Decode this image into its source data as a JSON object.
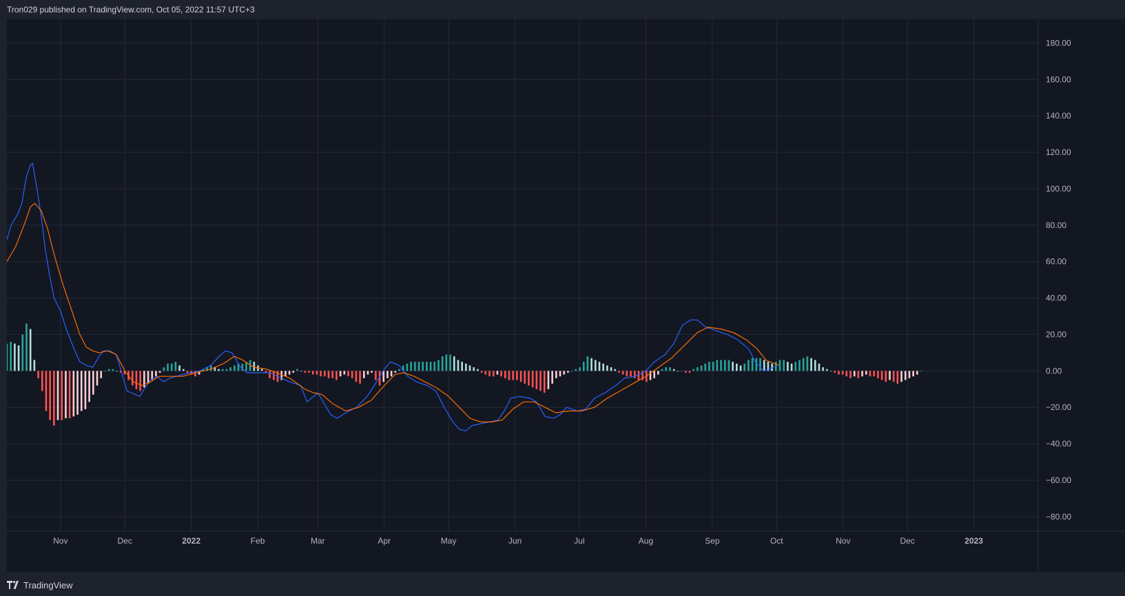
{
  "header": {
    "text": "Tron029 published on TradingView.com, Oct 05, 2022 11:57 UTC+3"
  },
  "footer": {
    "brand": "TradingView",
    "logo_icon": "tradingview-logo-icon"
  },
  "colors": {
    "background": "#131722",
    "frame": "#1e222d",
    "grid": "#252a37",
    "text": "#b2b5be",
    "macd_line": "#2962ff",
    "signal_line": "#ff6d00",
    "hist_pos_grow": "#26a69a",
    "hist_pos_fall": "#b2dfdb",
    "hist_neg_grow": "#ff5252",
    "hist_neg_fall": "#ffcdd2"
  },
  "chart_data": {
    "type": "line",
    "title": "",
    "xlabel": "",
    "ylabel": "",
    "x_range": [
      "2021-10-07",
      "2023-01-31"
    ],
    "ylim": [
      -88,
      193
    ],
    "grid": true,
    "x_ticks": [
      {
        "date": "2021-11-01",
        "label": "Nov",
        "bold": false
      },
      {
        "date": "2021-12-01",
        "label": "Dec",
        "bold": false
      },
      {
        "date": "2022-01-01",
        "label": "2022",
        "bold": true
      },
      {
        "date": "2022-02-01",
        "label": "Feb",
        "bold": false
      },
      {
        "date": "2022-03-01",
        "label": "Mar",
        "bold": false
      },
      {
        "date": "2022-04-01",
        "label": "Apr",
        "bold": false
      },
      {
        "date": "2022-05-01",
        "label": "May",
        "bold": false
      },
      {
        "date": "2022-06-01",
        "label": "Jun",
        "bold": false
      },
      {
        "date": "2022-07-01",
        "label": "Jul",
        "bold": false
      },
      {
        "date": "2022-08-01",
        "label": "Aug",
        "bold": false
      },
      {
        "date": "2022-09-01",
        "label": "Sep",
        "bold": false
      },
      {
        "date": "2022-10-01",
        "label": "Oct",
        "bold": false
      },
      {
        "date": "2022-11-01",
        "label": "Nov",
        "bold": false
      },
      {
        "date": "2022-12-01",
        "label": "Dec",
        "bold": false
      },
      {
        "date": "2023-01-01",
        "label": "2023",
        "bold": true
      }
    ],
    "y_ticks": [
      {
        "value": 180,
        "label": "180.00"
      },
      {
        "value": 160,
        "label": "160.00"
      },
      {
        "value": 140,
        "label": "140.00"
      },
      {
        "value": 120,
        "label": "120.00"
      },
      {
        "value": 100,
        "label": "100.00"
      },
      {
        "value": 80,
        "label": "80.00"
      },
      {
        "value": 60,
        "label": "60.00"
      },
      {
        "value": 40,
        "label": "40.00"
      },
      {
        "value": 20,
        "label": "20.00"
      },
      {
        "value": 0,
        "label": "0.00"
      },
      {
        "value": -20,
        "label": "−20.00"
      },
      {
        "value": -40,
        "label": "−40.00"
      },
      {
        "value": -60,
        "label": "−60.00"
      },
      {
        "value": -80,
        "label": "−80.00"
      }
    ],
    "series": [
      {
        "color_key": "macd_line",
        "points": [
          [
            "2021-10-07",
            72
          ],
          [
            "2021-10-09",
            80
          ],
          [
            "2021-10-12",
            86
          ],
          [
            "2021-10-14",
            92
          ],
          [
            "2021-10-16",
            106
          ],
          [
            "2021-10-18",
            113
          ],
          [
            "2021-10-19",
            114
          ],
          [
            "2021-10-21",
            100
          ],
          [
            "2021-10-23",
            85
          ],
          [
            "2021-10-25",
            66
          ],
          [
            "2021-10-27",
            52
          ],
          [
            "2021-10-29",
            40
          ],
          [
            "2021-11-01",
            33
          ],
          [
            "2021-11-04",
            22
          ],
          [
            "2021-11-07",
            13
          ],
          [
            "2021-11-10",
            5
          ],
          [
            "2021-11-13",
            3
          ],
          [
            "2021-11-16",
            2
          ],
          [
            "2021-11-19",
            8
          ],
          [
            "2021-11-21",
            11
          ],
          [
            "2021-11-24",
            11
          ],
          [
            "2021-11-27",
            9
          ],
          [
            "2021-11-30",
            -3
          ],
          [
            "2021-12-02",
            -11
          ],
          [
            "2021-12-04",
            -12
          ],
          [
            "2021-12-08",
            -14
          ],
          [
            "2021-12-10",
            -10
          ],
          [
            "2021-12-13",
            -5
          ],
          [
            "2021-12-16",
            -3
          ],
          [
            "2021-12-19",
            -6
          ],
          [
            "2021-12-22",
            -4
          ],
          [
            "2021-12-25",
            -3
          ],
          [
            "2021-12-31",
            -1
          ],
          [
            "2022-01-05",
            0
          ],
          [
            "2022-01-10",
            3
          ],
          [
            "2022-01-14",
            8
          ],
          [
            "2022-01-17",
            11
          ],
          [
            "2022-01-20",
            10
          ],
          [
            "2022-01-24",
            2
          ],
          [
            "2022-01-27",
            -1
          ],
          [
            "2022-02-01",
            -1
          ],
          [
            "2022-02-07",
            -1
          ],
          [
            "2022-02-12",
            -4
          ],
          [
            "2022-02-16",
            -6
          ],
          [
            "2022-02-21",
            -8
          ],
          [
            "2022-02-24",
            -17
          ],
          [
            "2022-02-27",
            -14
          ],
          [
            "2022-03-01",
            -12
          ],
          [
            "2022-03-04",
            -18
          ],
          [
            "2022-03-07",
            -24
          ],
          [
            "2022-03-10",
            -26
          ],
          [
            "2022-03-14",
            -23
          ],
          [
            "2022-03-19",
            -20
          ],
          [
            "2022-03-24",
            -14
          ],
          [
            "2022-03-29",
            -5
          ],
          [
            "2022-04-01",
            1
          ],
          [
            "2022-04-04",
            5
          ],
          [
            "2022-04-08",
            3
          ],
          [
            "2022-04-12",
            -3
          ],
          [
            "2022-04-16",
            -6
          ],
          [
            "2022-04-21",
            -8
          ],
          [
            "2022-04-25",
            -11
          ],
          [
            "2022-04-29",
            -20
          ],
          [
            "2022-05-03",
            -28
          ],
          [
            "2022-05-06",
            -32
          ],
          [
            "2022-05-09",
            -33
          ],
          [
            "2022-05-12",
            -30
          ],
          [
            "2022-05-16",
            -29
          ],
          [
            "2022-05-20",
            -28
          ],
          [
            "2022-05-24",
            -27
          ],
          [
            "2022-05-27",
            -22
          ],
          [
            "2022-05-30",
            -15
          ],
          [
            "2022-06-03",
            -14
          ],
          [
            "2022-06-08",
            -15
          ],
          [
            "2022-06-11",
            -17
          ],
          [
            "2022-06-15",
            -25
          ],
          [
            "2022-06-19",
            -26
          ],
          [
            "2022-06-22",
            -24
          ],
          [
            "2022-06-25",
            -20
          ],
          [
            "2022-06-30",
            -22
          ],
          [
            "2022-07-04",
            -21
          ],
          [
            "2022-07-08",
            -15
          ],
          [
            "2022-07-13",
            -12
          ],
          [
            "2022-07-18",
            -8
          ],
          [
            "2022-07-22",
            -4
          ],
          [
            "2022-07-27",
            -3
          ],
          [
            "2022-08-01",
            0
          ],
          [
            "2022-08-05",
            5
          ],
          [
            "2022-08-10",
            9
          ],
          [
            "2022-08-14",
            15
          ],
          [
            "2022-08-18",
            25
          ],
          [
            "2022-08-22",
            28
          ],
          [
            "2022-08-25",
            28
          ],
          [
            "2022-08-29",
            24
          ],
          [
            "2022-09-03",
            22
          ],
          [
            "2022-09-08",
            20
          ],
          [
            "2022-09-13",
            17
          ],
          [
            "2022-09-18",
            12
          ],
          [
            "2022-09-21",
            5
          ],
          [
            "2022-09-25",
            0
          ],
          [
            "2022-09-28",
            1
          ],
          [
            "2022-10-01",
            3
          ]
        ]
      },
      {
        "color_key": "signal_line",
        "points": [
          [
            "2021-10-07",
            60
          ],
          [
            "2021-10-11",
            68
          ],
          [
            "2021-10-15",
            80
          ],
          [
            "2021-10-18",
            90
          ],
          [
            "2021-10-20",
            92
          ],
          [
            "2021-10-23",
            88
          ],
          [
            "2021-10-26",
            78
          ],
          [
            "2021-10-29",
            64
          ],
          [
            "2021-11-02",
            48
          ],
          [
            "2021-11-06",
            34
          ],
          [
            "2021-11-10",
            20
          ],
          [
            "2021-11-13",
            13
          ],
          [
            "2021-11-16",
            11
          ],
          [
            "2021-11-19",
            10
          ],
          [
            "2021-11-23",
            11
          ],
          [
            "2021-11-27",
            9
          ],
          [
            "2021-12-01",
            0
          ],
          [
            "2021-12-05",
            -6
          ],
          [
            "2021-12-09",
            -8
          ],
          [
            "2021-12-13",
            -6
          ],
          [
            "2021-12-17",
            -3
          ],
          [
            "2021-12-22",
            -3
          ],
          [
            "2021-12-28",
            -3
          ],
          [
            "2022-01-03",
            -1
          ],
          [
            "2022-01-10",
            1
          ],
          [
            "2022-01-16",
            4
          ],
          [
            "2022-01-21",
            8
          ],
          [
            "2022-01-25",
            6
          ],
          [
            "2022-01-30",
            2
          ],
          [
            "2022-02-05",
            1
          ],
          [
            "2022-02-10",
            -1
          ],
          [
            "2022-02-16",
            -4
          ],
          [
            "2022-02-23",
            -10
          ],
          [
            "2022-02-27",
            -12
          ],
          [
            "2022-03-03",
            -13
          ],
          [
            "2022-03-08",
            -18
          ],
          [
            "2022-03-14",
            -22
          ],
          [
            "2022-03-20",
            -20
          ],
          [
            "2022-03-26",
            -16
          ],
          [
            "2022-04-01",
            -8
          ],
          [
            "2022-04-06",
            -2
          ],
          [
            "2022-04-10",
            -1
          ],
          [
            "2022-04-15",
            -3
          ],
          [
            "2022-04-20",
            -6
          ],
          [
            "2022-04-25",
            -9
          ],
          [
            "2022-05-01",
            -14
          ],
          [
            "2022-05-06",
            -20
          ],
          [
            "2022-05-11",
            -26
          ],
          [
            "2022-05-16",
            -28
          ],
          [
            "2022-05-21",
            -28
          ],
          [
            "2022-05-26",
            -27
          ],
          [
            "2022-05-31",
            -21
          ],
          [
            "2022-06-05",
            -17
          ],
          [
            "2022-06-10",
            -17
          ],
          [
            "2022-06-15",
            -20
          ],
          [
            "2022-06-20",
            -23
          ],
          [
            "2022-06-26",
            -22
          ],
          [
            "2022-07-02",
            -22
          ],
          [
            "2022-07-08",
            -20
          ],
          [
            "2022-07-14",
            -15
          ],
          [
            "2022-07-20",
            -11
          ],
          [
            "2022-07-26",
            -7
          ],
          [
            "2022-08-01",
            -3
          ],
          [
            "2022-08-07",
            2
          ],
          [
            "2022-08-13",
            7
          ],
          [
            "2022-08-19",
            14
          ],
          [
            "2022-08-25",
            21
          ],
          [
            "2022-08-30",
            24
          ],
          [
            "2022-09-05",
            23
          ],
          [
            "2022-09-11",
            21
          ],
          [
            "2022-09-17",
            17
          ],
          [
            "2022-09-22",
            12
          ],
          [
            "2022-09-26",
            6
          ],
          [
            "2022-09-30",
            4
          ],
          [
            "2022-10-02",
            3
          ]
        ]
      }
    ],
    "histogram": {
      "start": "2021-10-07",
      "step_days": 1.83,
      "values": [
        15,
        16,
        15,
        14,
        20,
        26,
        23,
        6,
        -4,
        -11,
        -22,
        -27,
        -30,
        -27,
        -27,
        -26,
        -26,
        -25,
        -24,
        -22,
        -21,
        -17,
        -13,
        -8,
        -4,
        0,
        1,
        1,
        0,
        -1,
        -2,
        -5,
        -8,
        -10,
        -11,
        -9,
        -7,
        -5,
        -3,
        -1,
        2,
        4,
        4,
        5,
        3,
        1,
        -1,
        -2,
        -3,
        -2,
        1,
        2,
        3,
        2,
        1,
        1,
        1,
        2,
        3,
        4,
        4,
        5,
        6,
        5,
        3,
        1,
        -1,
        -4,
        -5,
        -6,
        -5,
        -3,
        -2,
        -1,
        1,
        0,
        -1,
        -1,
        -2,
        -2,
        -3,
        -3,
        -4,
        -4,
        -5,
        -3,
        -2,
        -3,
        -4,
        -6,
        -7,
        -4,
        -2,
        -1,
        -5,
        -8,
        -6,
        -4,
        -3,
        -1,
        1,
        3,
        4,
        5,
        5,
        5,
        5,
        5,
        5,
        5,
        6,
        8,
        9,
        9,
        8,
        6,
        5,
        4,
        3,
        2,
        1,
        -1,
        -2,
        -3,
        -3,
        -2,
        -3,
        -4,
        -5,
        -5,
        -5,
        -6,
        -7,
        -8,
        -9,
        -10,
        -11,
        -12,
        -10,
        -7,
        -4,
        -3,
        -2,
        -1,
        0,
        1,
        2,
        5,
        8,
        7,
        6,
        5,
        4,
        3,
        2,
        1,
        -1,
        -2,
        -3,
        -3,
        -4,
        -5,
        -5,
        -6,
        -5,
        -4,
        -2,
        1,
        2,
        2,
        1,
        0,
        0,
        -1,
        -1,
        1,
        2,
        3,
        4,
        5,
        5,
        6,
        6,
        6,
        6,
        5,
        4,
        3,
        4,
        6,
        7,
        7,
        7,
        6,
        5,
        4,
        5,
        6,
        6,
        5,
        4,
        5,
        6,
        7,
        8,
        7,
        6,
        4,
        2,
        1,
        0,
        -1,
        -2,
        -2,
        -3,
        -4,
        -3,
        -4,
        -3,
        -2,
        -3,
        -3,
        -4,
        -5,
        -6,
        -5,
        -6,
        -7,
        -6,
        -5,
        -4,
        -3,
        -2,
        0
      ]
    }
  }
}
